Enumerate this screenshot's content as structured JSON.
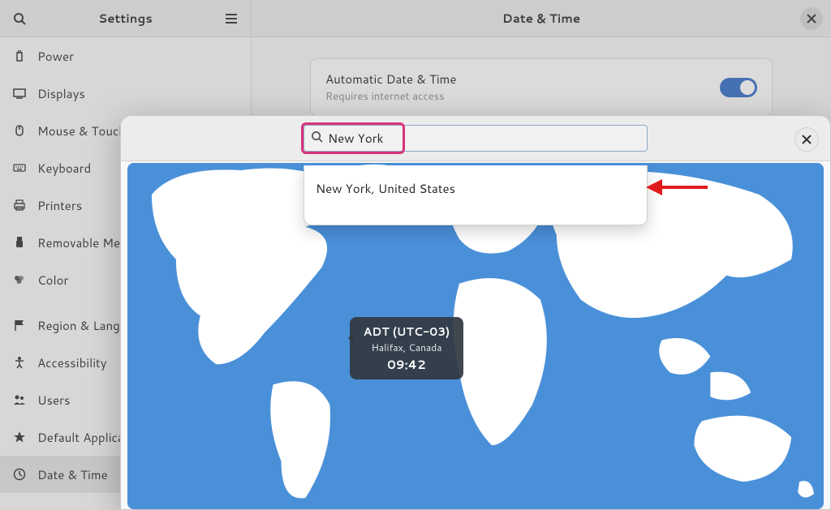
{
  "sidebar": {
    "title": "Settings",
    "items": [
      {
        "label": "Power",
        "icon": "power"
      },
      {
        "label": "Displays",
        "icon": "display"
      },
      {
        "label": "Mouse & Touchpad",
        "icon": "mouse"
      },
      {
        "label": "Keyboard",
        "icon": "keyboard"
      },
      {
        "label": "Printers",
        "icon": "printer"
      },
      {
        "label": "Removable Media",
        "icon": "usb"
      },
      {
        "label": "Color",
        "icon": "color"
      },
      {
        "label": "Region & Language",
        "icon": "flag"
      },
      {
        "label": "Accessibility",
        "icon": "accessibility"
      },
      {
        "label": "Users",
        "icon": "users"
      },
      {
        "label": "Default Applications",
        "icon": "star"
      },
      {
        "label": "Date & Time",
        "icon": "clock",
        "active": true
      }
    ]
  },
  "main": {
    "title": "Date & Time",
    "auto_card": {
      "title": "Automatic Date & Time",
      "subtitle": "Requires internet access",
      "enabled": true
    }
  },
  "dialog": {
    "search_value": "New York",
    "dropdown_items": [
      "New York, United States"
    ],
    "selected": {
      "tz_label": "ADT (UTC-03)",
      "location": "Halifax, Canada",
      "time": "09:42"
    }
  },
  "annotations": {
    "arrow_color": "#e01b1b"
  }
}
